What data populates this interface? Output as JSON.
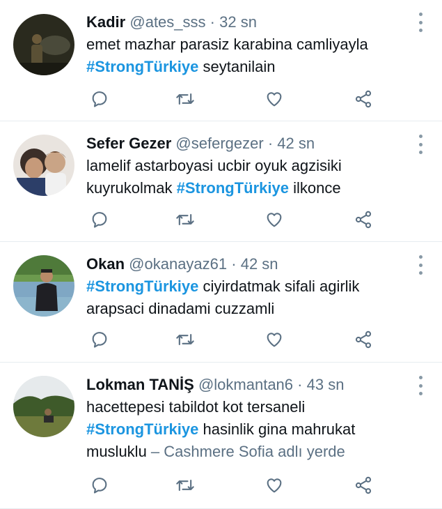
{
  "tweets": [
    {
      "name": "Kadir",
      "handle": "@ates_sss",
      "dot": "·",
      "time": "32 sn",
      "body_pre": "emet mazhar parasiz karabina camliyayla",
      "hashtag": "#StrongTürkiye",
      "body_post": " seytanilain"
    },
    {
      "name": "Sefer Gezer",
      "handle": "@sefergezer",
      "dot": "·",
      "time": "42 sn",
      "body_pre": "lamelif astarboyasi ucbir oyuk agzisiki kuyrukolmak ",
      "hashtag": "#StrongTürkiye",
      "body_post": " ilkonce"
    },
    {
      "name": "Okan",
      "handle": "@okanayaz61",
      "dot": "·",
      "time": "42 sn",
      "body_pre": "",
      "hashtag": "#StrongTürkiye",
      "body_post": " ciyirdatmak sifali agirlik arapsaci dinadami cuzzamli"
    },
    {
      "name": "Lokman TANİŞ",
      "handle": "@lokmantan6",
      "dot": "·",
      "time": "43 sn",
      "body_pre": "hacettepesi tabildot kot tersaneli",
      "hashtag": "#StrongTürkiye",
      "body_post": " hasinlik gina mahrukat musluklu",
      "location_sep": " – ",
      "location": "Cashmere Sofia adlı yerde"
    }
  ],
  "colors": {
    "hashtag": "#1b95e0",
    "muted": "#5b7083",
    "divider": "#e6ecf0"
  },
  "icons": [
    "reply-icon",
    "retweet-icon",
    "like-icon",
    "share-icon",
    "more-options-icon"
  ]
}
